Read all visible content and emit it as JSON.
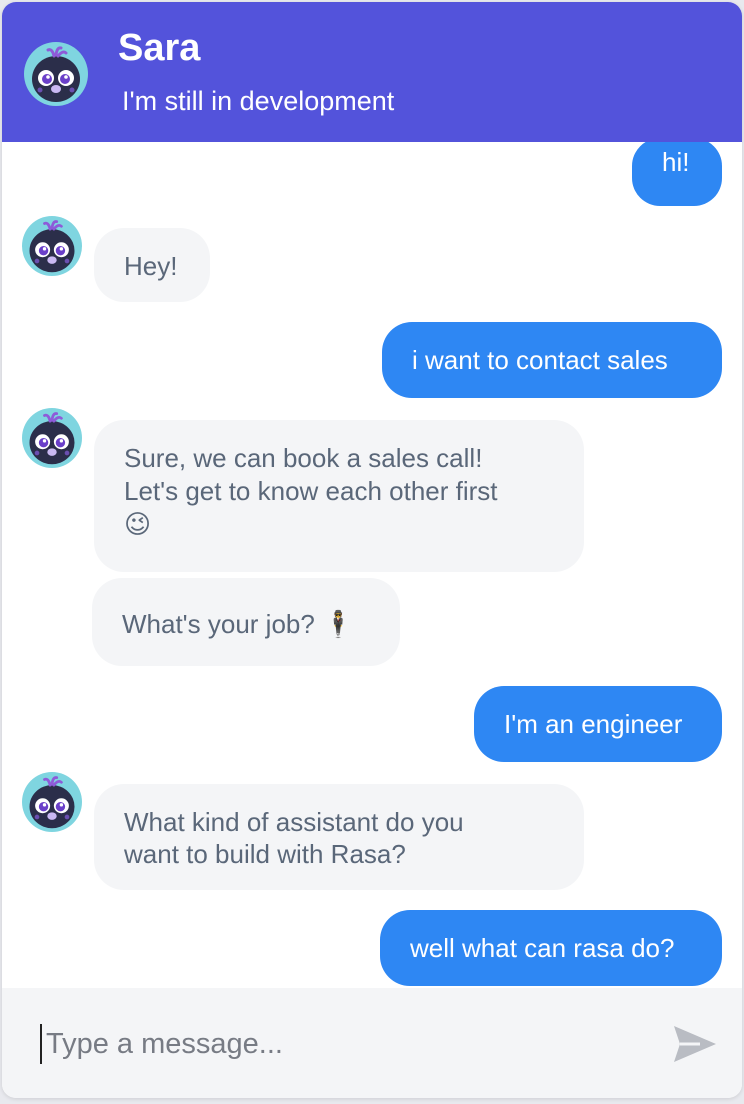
{
  "header": {
    "title": "Sara",
    "subtitle": "I'm still in development",
    "background_color": "#5353db"
  },
  "messages": [
    {
      "sender": "user",
      "text": "hi!"
    },
    {
      "sender": "bot",
      "text": "Hey!"
    },
    {
      "sender": "user",
      "text": "i want to contact sales"
    },
    {
      "sender": "bot",
      "text": "Sure, we can book a sales call!\nLet's get to know each other first\n😉"
    },
    {
      "sender": "bot",
      "text": "What's your job? 🕴"
    },
    {
      "sender": "user",
      "text": "I'm an engineer"
    },
    {
      "sender": "bot",
      "text": "What kind of assistant do you\nwant to build with Rasa?"
    },
    {
      "sender": "user",
      "text": "well what can rasa do?"
    }
  ],
  "composer": {
    "placeholder": "Type a message...",
    "send_icon": "send-icon"
  },
  "colors": {
    "user_bubble": "#2e87f3",
    "bot_bubble": "#f4f5f7",
    "bot_text": "#5a6779"
  }
}
